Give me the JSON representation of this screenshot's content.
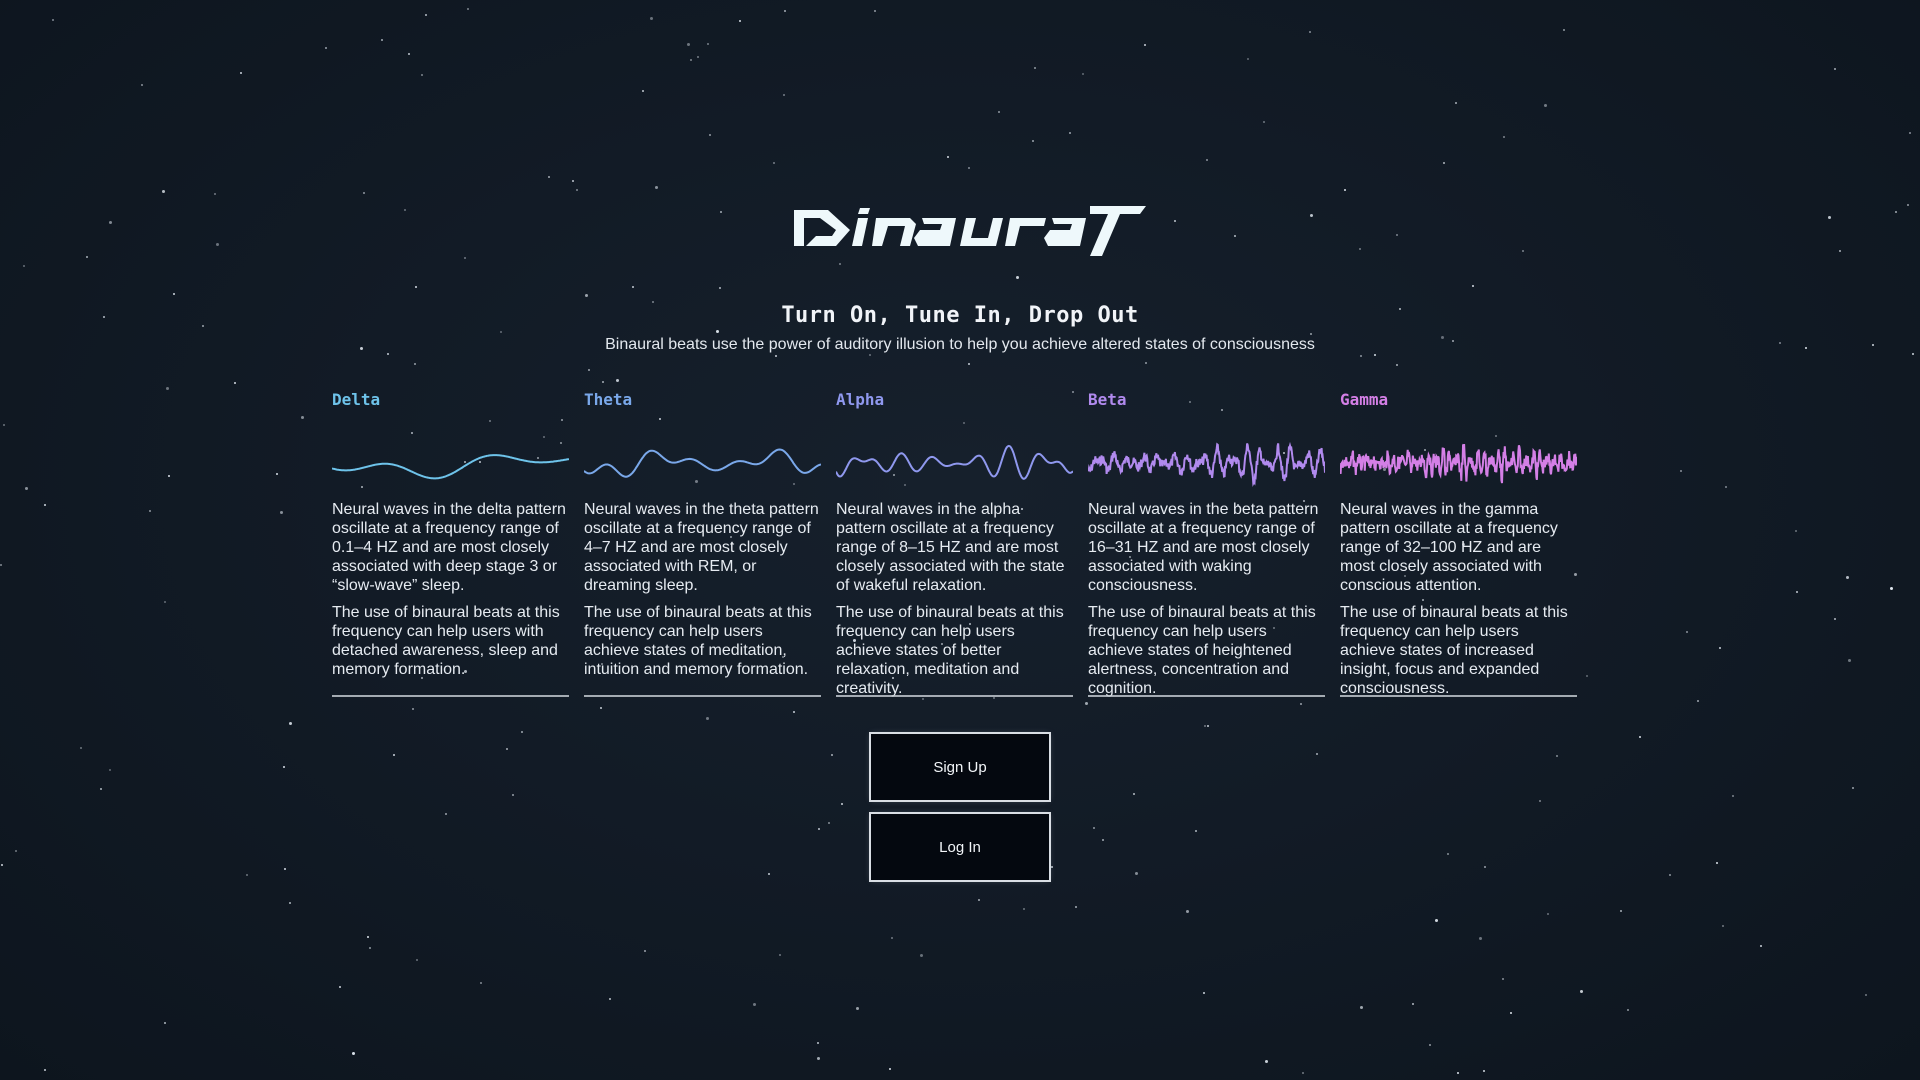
{
  "brand": {
    "logo_text": "binaural"
  },
  "hero": {
    "tagline": "Turn On, Tune In, Drop Out",
    "subtitle": "Binaural beats use the power of auditory illusion to help you achieve altered states of consciousness"
  },
  "waves": [
    {
      "name": "Delta",
      "color": "#6ec3ea",
      "description": "Neural waves in the delta pattern oscillate at a frequency range of 0.1–4 HZ and are most closely associated with deep stage 3 or “slow-wave” sleep.",
      "use": "The use of binaural beats at this frequency can help users with detached awareness, sleep and memory formation."
    },
    {
      "name": "Theta",
      "color": "#7aa8ea",
      "description": "Neural waves in the theta pattern oscillate at a frequency range of 4–7 HZ and are most closely associated with REM, or dreaming sleep.",
      "use": "The use of binaural beats at this frequency can help users achieve states of meditation, intuition and memory formation."
    },
    {
      "name": "Alpha",
      "color": "#8f98ee",
      "description": "Neural waves in the alpha pattern oscillate at a frequency range of 8–15 HZ and are most closely associated with the state of wakeful relaxation.",
      "use": "The use of binaural beats at this frequency can help users achieve states of better relaxation, meditation and creativity."
    },
    {
      "name": "Beta",
      "color": "#b18aee",
      "description": "Neural waves in the beta pattern oscillate at a frequency range of 16–31 HZ and are most closely associated with waking consciousness.",
      "use": "The use of binaural beats at this frequency can help users achieve states of heightened alertness, concentration and cognition."
    },
    {
      "name": "Gamma",
      "color": "#d47fe6",
      "description": "Neural waves in the gamma pattern oscillate at a frequency range of 32–100 HZ and are most closely associated with conscious attention.",
      "use": "The use of binaural beats at this frequency can help users achieve states of increased insight, focus and expanded consciousness."
    }
  ],
  "actions": {
    "signup_label": "Sign Up",
    "login_label": "Log In"
  }
}
